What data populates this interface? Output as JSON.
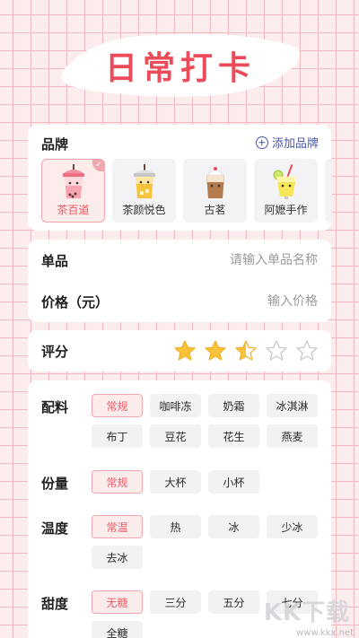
{
  "title": "日常打卡",
  "brand": {
    "label": "品牌",
    "add_label": "添加品牌",
    "items": [
      {
        "name": "茶百道",
        "selected": true
      },
      {
        "name": "茶颜悦色",
        "selected": false
      },
      {
        "name": "古茗",
        "selected": false
      },
      {
        "name": "阿嬷手作",
        "selected": false
      }
    ]
  },
  "item": {
    "label": "单品",
    "placeholder": "请输入单品名称"
  },
  "price": {
    "label": "价格（元）",
    "placeholder": "输入价格"
  },
  "rating": {
    "label": "评分",
    "value": 2.5,
    "max": 5,
    "fill_color": "#f7c33b"
  },
  "toppings": {
    "label": "配料",
    "options": [
      "常规",
      "咖啡冻",
      "奶霜",
      "冰淇淋",
      "布丁",
      "豆花",
      "花生",
      "燕麦"
    ],
    "selected": "常规"
  },
  "size": {
    "label": "份量",
    "options": [
      "常规",
      "大杯",
      "小杯"
    ],
    "selected": "常规"
  },
  "temperature": {
    "label": "温度",
    "options": [
      "常温",
      "热",
      "冰",
      "少冰",
      "去冰"
    ],
    "selected": "常温"
  },
  "sweetness": {
    "label": "甜度",
    "options": [
      "无糖",
      "三分",
      "五分",
      "七分",
      "全糖"
    ],
    "selected": "无糖"
  },
  "watermark": {
    "logo": "KK下载",
    "url": "www.kkx.net"
  },
  "colors": {
    "accent": "#ec4b5a",
    "link": "#4a57a8",
    "chip_active_bg": "#fdecec"
  }
}
